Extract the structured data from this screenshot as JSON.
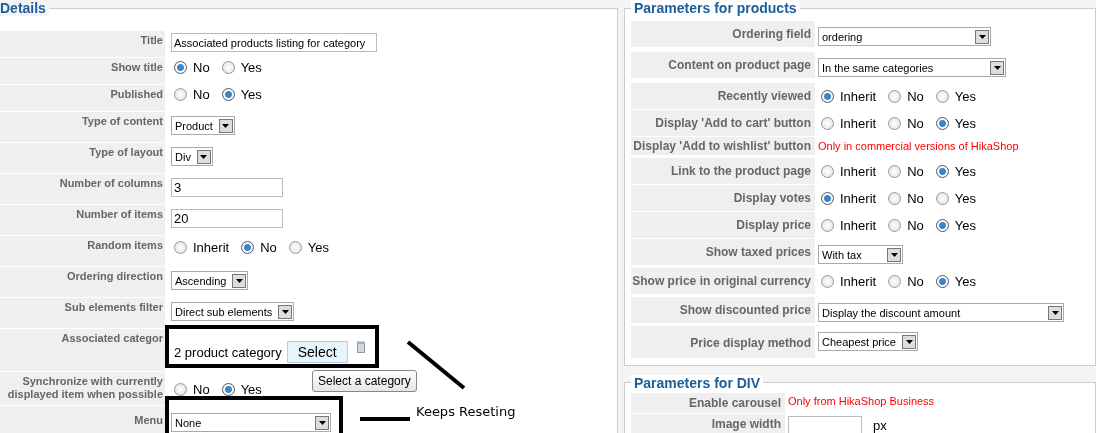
{
  "details": {
    "legend": "Details",
    "rows": [
      {
        "label": "Title",
        "kind": "text",
        "value": "Associated products listing for category"
      },
      {
        "label": "Show title",
        "kind": "radio",
        "options": [
          {
            "label": "No",
            "selected": true
          },
          {
            "label": "Yes",
            "selected": false
          }
        ]
      },
      {
        "label": "Published",
        "kind": "radio",
        "options": [
          {
            "label": "No",
            "selected": false
          },
          {
            "label": "Yes",
            "selected": true
          }
        ]
      },
      {
        "label": "Type of content",
        "kind": "select",
        "value": "Product"
      },
      {
        "label": "Type of layout",
        "kind": "select",
        "value": "Div"
      },
      {
        "label": "Number of columns",
        "kind": "text",
        "value": "3"
      },
      {
        "label": "Number of items",
        "kind": "text",
        "value": "20"
      },
      {
        "label": "Random items",
        "kind": "radio",
        "options": [
          {
            "label": "Inherit",
            "selected": false
          },
          {
            "label": "No",
            "selected": true
          },
          {
            "label": "Yes",
            "selected": false
          }
        ]
      },
      {
        "label": "Ordering direction",
        "kind": "select",
        "value": "Ascending"
      },
      {
        "label": "Sub elements filter",
        "kind": "select",
        "value": "Direct sub elements"
      },
      {
        "label": "Associated categor",
        "kind": "category",
        "value": "2 product category",
        "button": "Select"
      },
      {
        "label": "Synchronize with currently displayed item when possible",
        "kind": "radio",
        "options": [
          {
            "label": "No",
            "selected": false
          },
          {
            "label": "Yes",
            "selected": true
          }
        ]
      },
      {
        "label": "Menu",
        "kind": "select",
        "value": "None"
      }
    ]
  },
  "products": {
    "legend": "Parameters for products",
    "rows": [
      {
        "label": "Ordering field",
        "kind": "select",
        "value": "ordering"
      },
      {
        "label": "Content on product page",
        "kind": "select",
        "value": "In the same categories"
      },
      {
        "label": "Recently viewed",
        "kind": "radio",
        "options": [
          {
            "label": "Inherit",
            "selected": true
          },
          {
            "label": "No",
            "selected": false
          },
          {
            "label": "Yes",
            "selected": false
          }
        ]
      },
      {
        "label": "Display 'Add to cart' button",
        "kind": "radio",
        "options": [
          {
            "label": "Inherit",
            "selected": false
          },
          {
            "label": "No",
            "selected": false
          },
          {
            "label": "Yes",
            "selected": true
          }
        ]
      },
      {
        "label": "Display 'Add to wishlist' button",
        "kind": "note",
        "value": "Only in commercial versions of HikaShop"
      },
      {
        "label": "Link to the product page",
        "kind": "radio",
        "options": [
          {
            "label": "Inherit",
            "selected": false
          },
          {
            "label": "No",
            "selected": false
          },
          {
            "label": "Yes",
            "selected": true
          }
        ]
      },
      {
        "label": "Display votes",
        "kind": "radio",
        "options": [
          {
            "label": "Inherit",
            "selected": true
          },
          {
            "label": "No",
            "selected": false
          },
          {
            "label": "Yes",
            "selected": false
          }
        ]
      },
      {
        "label": "Display price",
        "kind": "radio",
        "options": [
          {
            "label": "Inherit",
            "selected": false
          },
          {
            "label": "No",
            "selected": false
          },
          {
            "label": "Yes",
            "selected": true
          }
        ]
      },
      {
        "label": "Show taxed prices",
        "kind": "select",
        "value": "With tax"
      },
      {
        "label": "Show price in original currency",
        "kind": "radio",
        "options": [
          {
            "label": "Inherit",
            "selected": false
          },
          {
            "label": "No",
            "selected": false
          },
          {
            "label": "Yes",
            "selected": true
          }
        ]
      },
      {
        "label": "Show discounted price",
        "kind": "select",
        "value": "Display the discount amount"
      },
      {
        "label": "Price display method",
        "kind": "select",
        "value": "Cheapest price"
      }
    ]
  },
  "div": {
    "legend": "Parameters for DIV",
    "rows": [
      {
        "label": "Enable carousel",
        "kind": "note",
        "value": "Only from HikaShop Business"
      },
      {
        "label": "Image width",
        "kind": "text",
        "unit": "px"
      }
    ]
  },
  "tooltip": "Select a category",
  "annotation": "Keeps Reseting"
}
